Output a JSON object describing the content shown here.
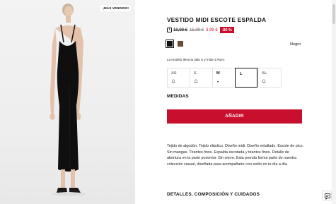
{
  "product": {
    "badge": "¡MÁS VENDIDO!",
    "title": "VESTIDO MIDI ESCOTE ESPALDA",
    "old_price": "19,99 €",
    "old_price_2": "15,99 €",
    "new_price": "3,99 €",
    "discount": "-80 %",
    "color_name": "Negro",
    "colors": [
      {
        "name": "black",
        "hex": "#111111"
      },
      {
        "name": "brown",
        "hex": "#6b4a3a"
      }
    ],
    "model_note": "La modelo lleva la talla S y mide 176cm.",
    "sizes": [
      {
        "label": "XS",
        "state": "unavailable"
      },
      {
        "label": "S",
        "state": "unavailable"
      },
      {
        "label": "M",
        "state": "few"
      },
      {
        "label": "L",
        "state": "selected"
      },
      {
        "label": "XL",
        "state": "unavailable"
      }
    ],
    "measures_label": "MEDIDAS",
    "add_label": "AÑADIR",
    "description": "Tejido de algodón. Tejido elástico. Diseño midi. Diseño entallado. Escote de pico. Sin mangas. Tirantes finos. Espalda escotada y tirantes finos. Detalle de abertura en la parte posterior. Sin cierre. Esta prenda forma parte de nuestra colección casual, diseñada para acompañarte con estilo en tu día a día",
    "details_label": "DETALLES, COMPOSICIÓN Y CUIDADOS"
  },
  "icons": {
    "info": "info-icon",
    "notify": "bell-icon",
    "chat": "chat-icon"
  },
  "colors": {
    "accent": "#c8102e",
    "text": "#111111"
  }
}
